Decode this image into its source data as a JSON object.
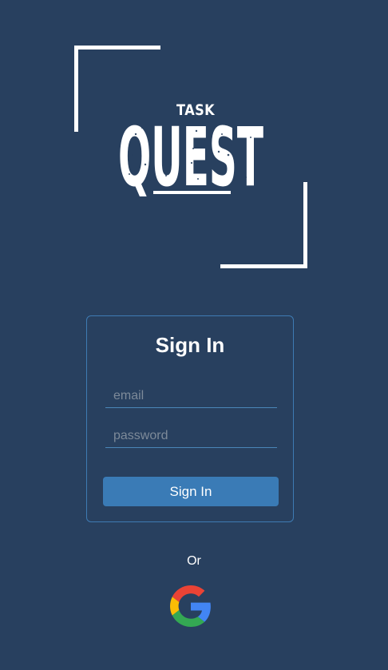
{
  "logo": {
    "small_word": "TASK",
    "big_word": "QUEST"
  },
  "signin": {
    "title": "Sign In",
    "email_placeholder": "email",
    "email_value": "",
    "password_placeholder": "password",
    "password_value": "",
    "button_label": "Sign In"
  },
  "alt_login": {
    "or_label": "Or",
    "google_icon": "google-icon"
  },
  "colors": {
    "background": "#28405f",
    "card_border": "#3e7bb3",
    "button": "#3a7bb6",
    "text": "#ffffff"
  }
}
